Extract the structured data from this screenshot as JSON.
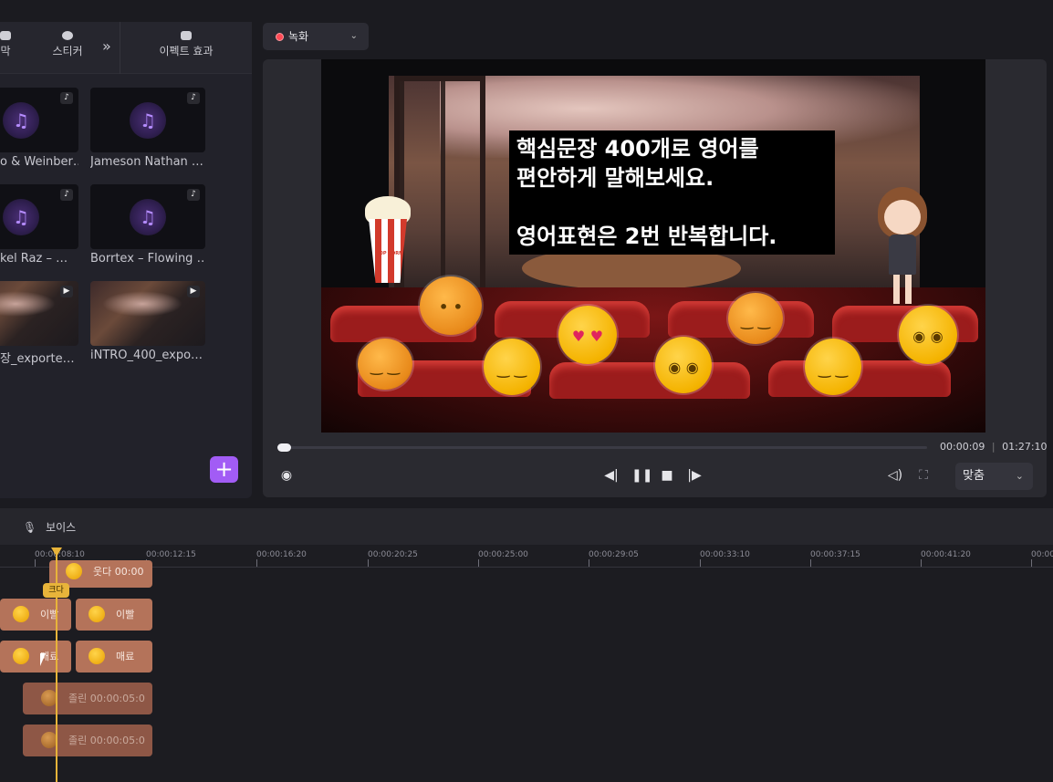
{
  "effects_panel": {
    "tabs": [
      {
        "label": "막",
        "icon": "caption-icon"
      },
      {
        "label": "스티커",
        "icon": "sticker-icon"
      },
      {
        "label": "이펙트 효과",
        "icon": "effects-icon"
      }
    ],
    "more_icon": "double-chevron-right-icon",
    "media": [
      {
        "label": "o & Weinber…",
        "kind": "audio"
      },
      {
        "label": "Jameson Nathan …",
        "kind": "audio"
      },
      {
        "label": "kel Raz – …",
        "kind": "audio"
      },
      {
        "label": "Borrtex – Flowing …",
        "kind": "audio"
      },
      {
        "label": "장_exporte…",
        "kind": "video"
      },
      {
        "label": "iNTRO_400_expo…",
        "kind": "video"
      }
    ],
    "add_label": "+"
  },
  "preview": {
    "record_label": "녹화",
    "caption_text": "핵심문장 400개로 영어를\n편안하게 말해보세요.\n\n영어표현은 2번 반복합니다.",
    "popcorn_text": "POP CORN",
    "progress_fraction": 0.0,
    "current_time": "00:00:09",
    "total_time": "01:27:10",
    "time_separator": "|",
    "fit_label": "맞춤"
  },
  "timeline": {
    "voice_label": "보이스",
    "ruler_labels": [
      "00:00:08:10",
      "00:00:12:15",
      "00:00:16:20",
      "00:00:20:25",
      "00:00:25:00",
      "00:00:29:05",
      "00:00:33:10",
      "00:00:37:15",
      "00:00:41:20",
      "00:00"
    ],
    "playhead_label": "크다",
    "clips": [
      {
        "label": "웃다  00:00"
      },
      {
        "label": "이빨"
      },
      {
        "label": "이빨"
      },
      {
        "label": "매료"
      },
      {
        "label": "매료"
      },
      {
        "label": "졸린  00:00:05:0"
      },
      {
        "label": "졸린  00:00:05:0"
      }
    ]
  },
  "colors": {
    "accent": "#a25cf5",
    "record": "#ff4a55",
    "playhead": "#e8b43a",
    "clip": "#b4735a"
  }
}
